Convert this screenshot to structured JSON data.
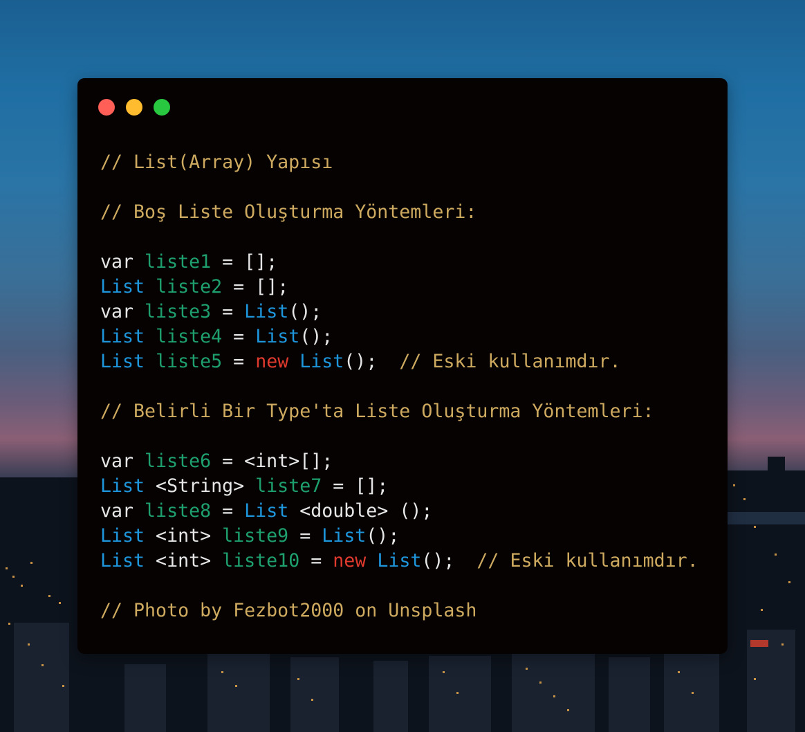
{
  "window": {
    "controls": {
      "close_color": "#ff5f57",
      "minimize_color": "#febc2e",
      "maximize_color": "#28c840"
    }
  },
  "code": {
    "lines": [
      [
        {
          "t": "// List(Array) Yapısı",
          "k": "comment"
        }
      ],
      [],
      [
        {
          "t": "// Boş Liste Oluşturma Yöntemleri:",
          "k": "comment"
        }
      ],
      [],
      [
        {
          "t": "var ",
          "k": "plain"
        },
        {
          "t": "liste1",
          "k": "var"
        },
        {
          "t": " = [];",
          "k": "plain"
        }
      ],
      [
        {
          "t": "List",
          "k": "type"
        },
        {
          "t": " ",
          "k": "plain"
        },
        {
          "t": "liste2",
          "k": "var"
        },
        {
          "t": " = [];",
          "k": "plain"
        }
      ],
      [
        {
          "t": "var ",
          "k": "plain"
        },
        {
          "t": "liste3",
          "k": "var"
        },
        {
          "t": " = ",
          "k": "plain"
        },
        {
          "t": "List",
          "k": "type"
        },
        {
          "t": "();",
          "k": "plain"
        }
      ],
      [
        {
          "t": "List",
          "k": "type"
        },
        {
          "t": " ",
          "k": "plain"
        },
        {
          "t": "liste4",
          "k": "var"
        },
        {
          "t": " = ",
          "k": "plain"
        },
        {
          "t": "List",
          "k": "type"
        },
        {
          "t": "();",
          "k": "plain"
        }
      ],
      [
        {
          "t": "List",
          "k": "type"
        },
        {
          "t": " ",
          "k": "plain"
        },
        {
          "t": "liste5",
          "k": "var"
        },
        {
          "t": " = ",
          "k": "plain"
        },
        {
          "t": "new",
          "k": "new"
        },
        {
          "t": " ",
          "k": "plain"
        },
        {
          "t": "List",
          "k": "type"
        },
        {
          "t": "();  ",
          "k": "plain"
        },
        {
          "t": "// Eski kullanımdır.",
          "k": "comment"
        }
      ],
      [],
      [
        {
          "t": "// Belirli Bir Type'ta Liste Oluşturma Yöntemleri:",
          "k": "comment"
        }
      ],
      [],
      [
        {
          "t": "var ",
          "k": "plain"
        },
        {
          "t": "liste6",
          "k": "var"
        },
        {
          "t": " = <int>[];",
          "k": "plain"
        }
      ],
      [
        {
          "t": "List",
          "k": "type"
        },
        {
          "t": " <String> ",
          "k": "plain"
        },
        {
          "t": "liste7",
          "k": "var"
        },
        {
          "t": " = [];",
          "k": "plain"
        }
      ],
      [
        {
          "t": "var ",
          "k": "plain"
        },
        {
          "t": "liste8",
          "k": "var"
        },
        {
          "t": " = ",
          "k": "plain"
        },
        {
          "t": "List",
          "k": "type"
        },
        {
          "t": " <double> ();",
          "k": "plain"
        }
      ],
      [
        {
          "t": "List",
          "k": "type"
        },
        {
          "t": " <int> ",
          "k": "plain"
        },
        {
          "t": "liste9",
          "k": "var"
        },
        {
          "t": " = ",
          "k": "plain"
        },
        {
          "t": "List",
          "k": "type"
        },
        {
          "t": "();",
          "k": "plain"
        }
      ],
      [
        {
          "t": "List",
          "k": "type"
        },
        {
          "t": " <int> ",
          "k": "plain"
        },
        {
          "t": "liste10",
          "k": "var"
        },
        {
          "t": " = ",
          "k": "plain"
        },
        {
          "t": "new",
          "k": "new"
        },
        {
          "t": " ",
          "k": "plain"
        },
        {
          "t": "List",
          "k": "type"
        },
        {
          "t": "();  ",
          "k": "plain"
        },
        {
          "t": "// Eski kullanımdır.",
          "k": "comment"
        }
      ],
      [],
      [
        {
          "t": "// Photo by Fezbot2000 on Unsplash",
          "k": "comment"
        }
      ]
    ]
  },
  "syntax_colors": {
    "comment": "#cdaa5f",
    "var": "#1ea06e",
    "type": "#1e96dc",
    "new": "#e03a2e",
    "plain": "#e6e6e6"
  }
}
